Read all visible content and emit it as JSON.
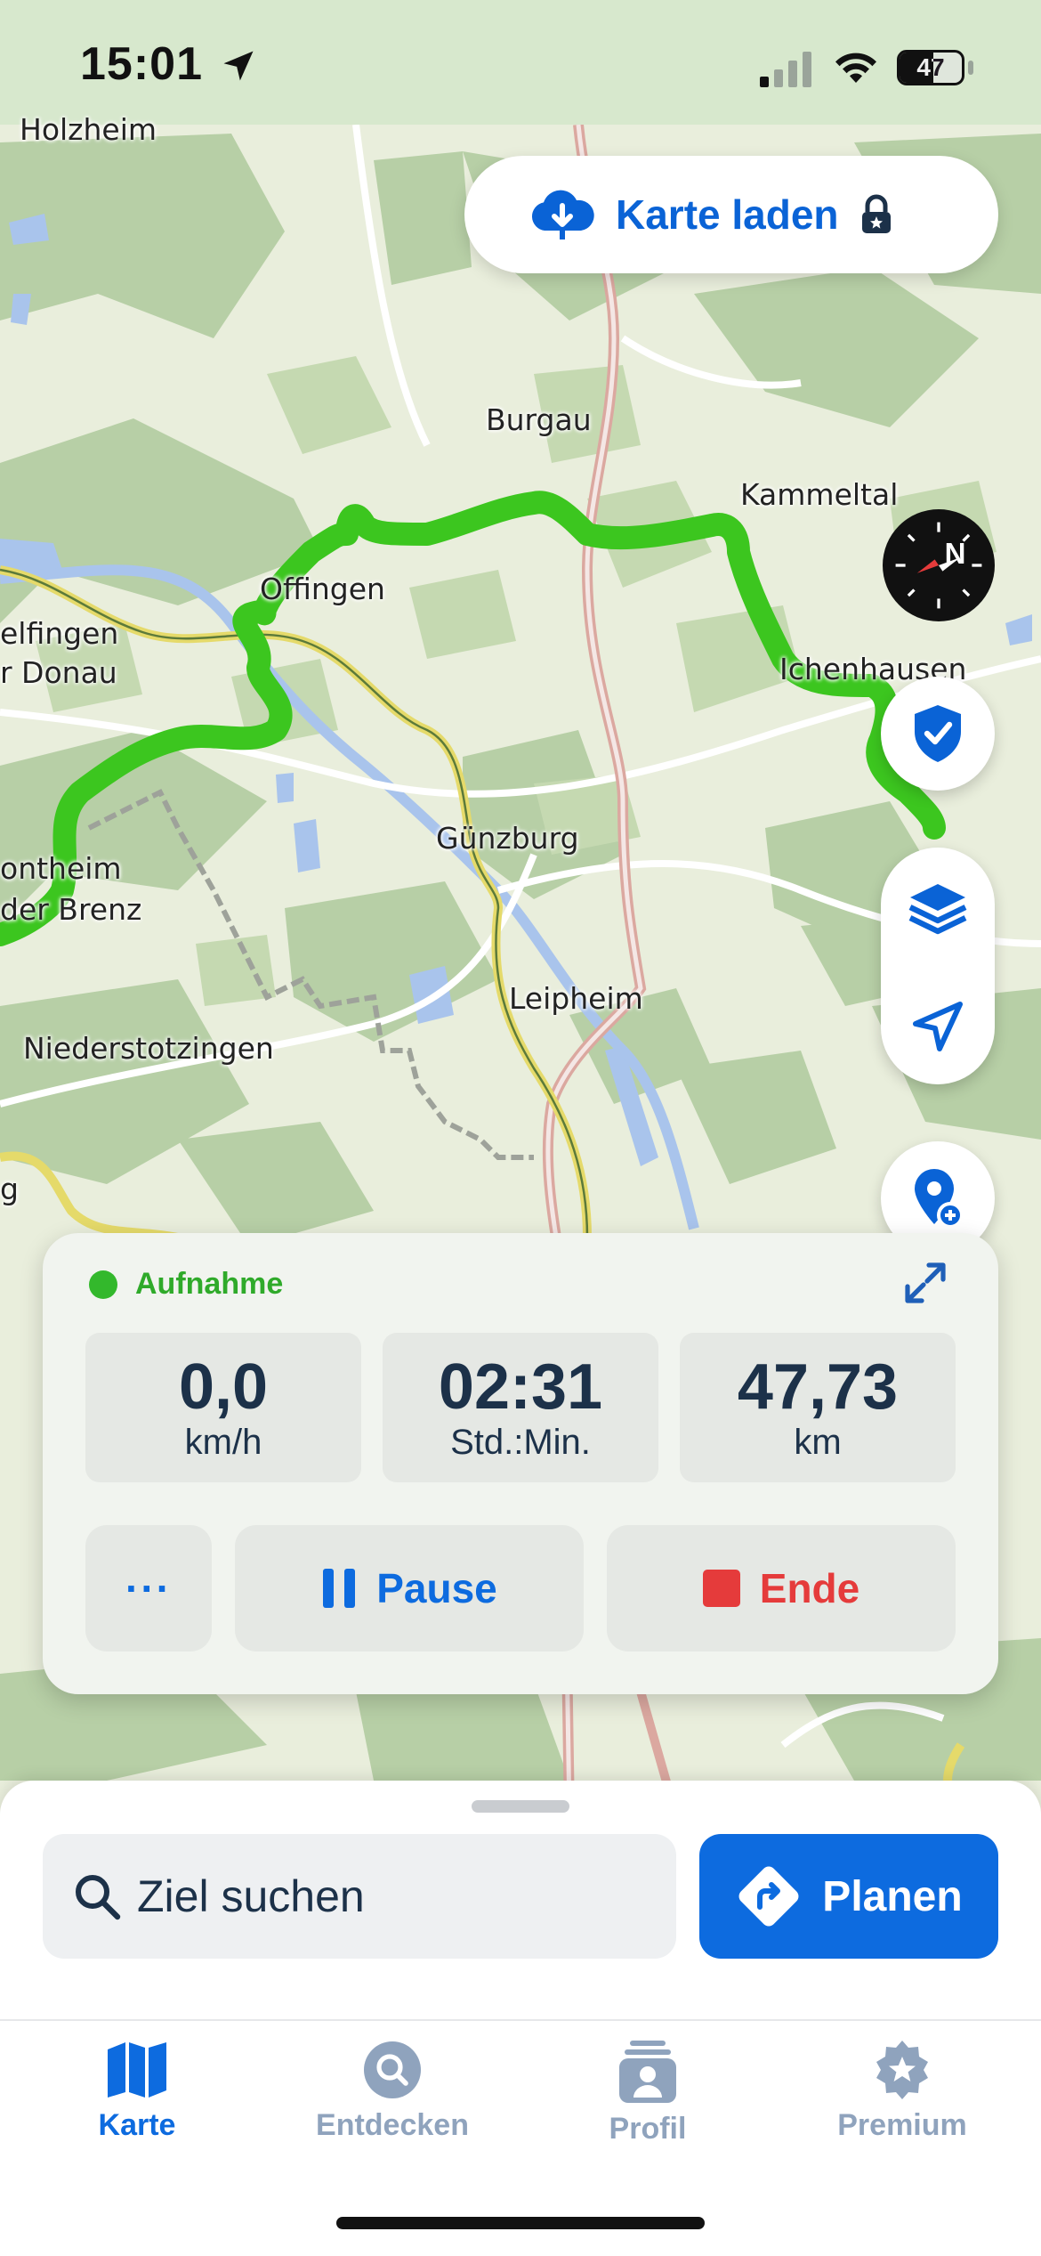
{
  "status_bar": {
    "time": "15:01",
    "battery": "47"
  },
  "map": {
    "places": [
      "Holzheim",
      "Burgau",
      "Kammeltal",
      "Offingen",
      "elfingen",
      "r Donau",
      "Ichenhausen",
      "ontheim",
      "der Brenz",
      "Günzburg",
      "Leipheim",
      "Niederstotzingen",
      "g"
    ]
  },
  "karte_laden": {
    "label": "Karte laden",
    "icons": [
      "cloud-download-icon",
      "lock-icon"
    ]
  },
  "recording": {
    "status": "Aufnahme",
    "stats": [
      {
        "value": "0,0",
        "unit": "km/h"
      },
      {
        "value": "02:31",
        "unit": "Std.:Min."
      },
      {
        "value": "47,73",
        "unit": "km"
      }
    ],
    "more_label": "···",
    "pause_label": "Pause",
    "end_label": "Ende"
  },
  "search": {
    "placeholder": "Ziel suchen"
  },
  "plan_button": {
    "label": "Planen"
  },
  "tabs": [
    {
      "label": "Karte",
      "active": true
    },
    {
      "label": "Entdecken",
      "active": false
    },
    {
      "label": "Profil",
      "active": false
    },
    {
      "label": "Premium",
      "active": false
    }
  ],
  "colors": {
    "accent": "#0d6bdf",
    "route": "#3cc61f",
    "recording": "#33b82c",
    "end": "#e53b3b"
  }
}
